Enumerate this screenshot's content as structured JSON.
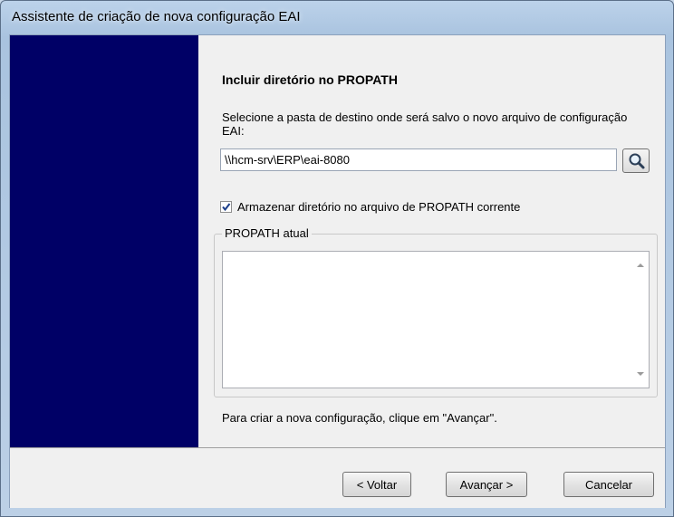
{
  "window": {
    "title": "Assistente de criação de nova configuração EAI"
  },
  "page": {
    "heading": "Incluir diretório no PROPATH",
    "description": "Selecione a pasta de destino onde será salvo o novo arquivo de configuração EAI:",
    "path_value": "\\\\hcm-srv\\ERP\\eai-8080",
    "browse_icon": "magnifier-icon",
    "checkbox_label": "Armazenar diretório no arquivo de PROPATH corrente",
    "checkbox_checked": true,
    "group_label": "PROPATH atual",
    "propath_text": "",
    "footer_text": "Para criar a nova configuração, clique em \"Avançar\"."
  },
  "buttons": {
    "back": "< Voltar",
    "next": "Avançar >",
    "cancel": "Cancelar"
  },
  "colors": {
    "sidebar": "#000066",
    "dialog_bg": "#f0f0f0"
  }
}
